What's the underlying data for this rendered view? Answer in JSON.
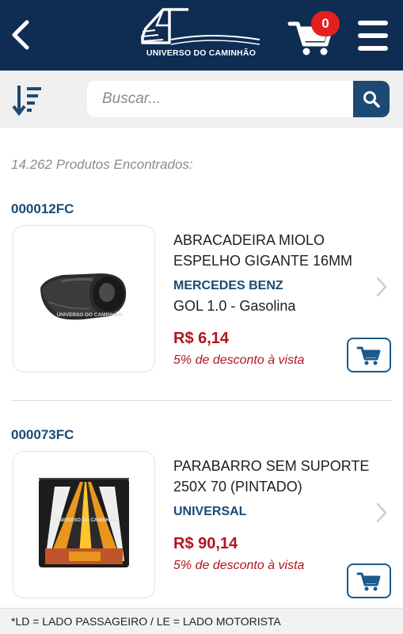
{
  "header": {
    "logo_text": "UNIVERSO DO CAMINHÃO",
    "cart_count": "0",
    "icons": {
      "back": "chevron-left-icon",
      "cart": "shopping-cart-icon",
      "menu": "hamburger-menu-icon"
    },
    "colors": {
      "background": "#0f2c52",
      "badge": "#e4201f"
    }
  },
  "search": {
    "placeholder": "Buscar...",
    "value": "",
    "icons": {
      "sort": "sort-descending-icon",
      "search": "search-icon"
    },
    "button_color": "#1c4a72"
  },
  "results": {
    "count_text": "14.262 Produtos Encontrados:"
  },
  "products": [
    {
      "code": "000012FC",
      "name_line1": "ABRACADEIRA MIOLO",
      "name_line2": "ESPELHO GIGANTE 16MM",
      "brand": "MERCEDES BENZ",
      "model": "GOL 1.0 - Gasolina",
      "price": "R$ 6,14",
      "discount": "5% de desconto à vista",
      "image_watermark": "UNIVERSO DO CAMINHÃO"
    },
    {
      "code": "000073FC",
      "name_line1": "PARABARRO SEM SUPORTE",
      "name_line2": "250X 70 (PINTADO)",
      "brand": "UNIVERSAL",
      "model": "",
      "price": "R$ 90,14",
      "discount": "5% de desconto à vista",
      "image_watermark": "UNIVERSO DO CAMINHÃO"
    }
  ],
  "footer": {
    "note": "*LD = LADO PASSAGEIRO / LE = LADO MOTORISTA"
  },
  "colors": {
    "brand_blue": "#1b4a75",
    "price_red": "#b2141e",
    "muted_text": "#8c8c8c"
  }
}
